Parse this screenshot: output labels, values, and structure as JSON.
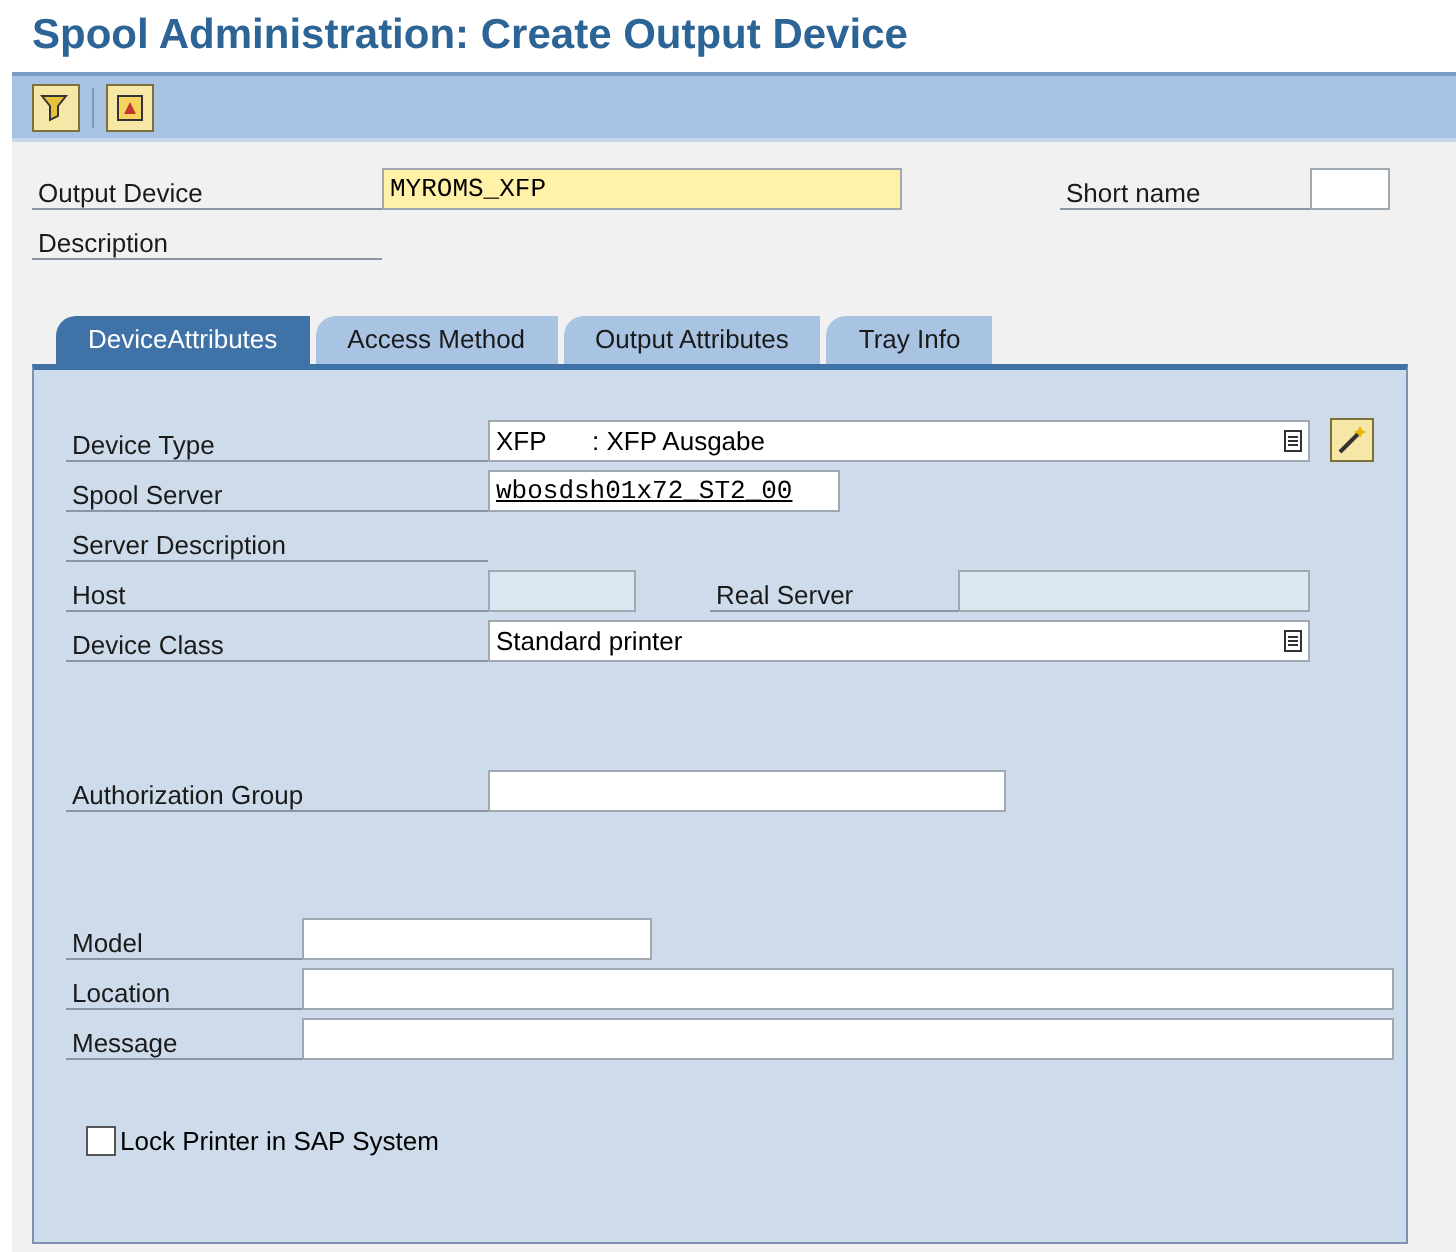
{
  "title": "Spool Administration: Create Output Device",
  "toolbar": [
    {
      "kind": "filter"
    },
    {
      "kind": "display"
    }
  ],
  "header": {
    "output_device": {
      "label": "Output Device",
      "value": "MYROMS_XFP"
    },
    "short_name": {
      "label": "Short name"
    },
    "description": {
      "label": "Description"
    }
  },
  "tabs": [
    {
      "label": "DeviceAttributes",
      "selected": true
    },
    {
      "label": "Access Method",
      "selected": false
    },
    {
      "label": "Output Attributes",
      "selected": false
    },
    {
      "label": "Tray Info",
      "selected": false
    }
  ],
  "device_type": {
    "label": "Device Type",
    "code": "XFP",
    "text": ": XFP Ausgabe"
  },
  "spool_server": {
    "label": "Spool Server",
    "value": "wbosdsh01x72_ST2_00"
  },
  "server_description": {
    "label": "Server Description"
  },
  "host": {
    "label": "Host"
  },
  "real_server": {
    "label": "Real Server"
  },
  "device_class": {
    "label": "Device Class",
    "value": "Standard printer"
  },
  "authorization_group": {
    "label": "Authorization Group"
  },
  "model": {
    "label": "Model"
  },
  "location": {
    "label": "Location"
  },
  "message": {
    "label": "Message"
  },
  "lock_printer": {
    "label": "Lock Printer in SAP System",
    "checked": false
  }
}
